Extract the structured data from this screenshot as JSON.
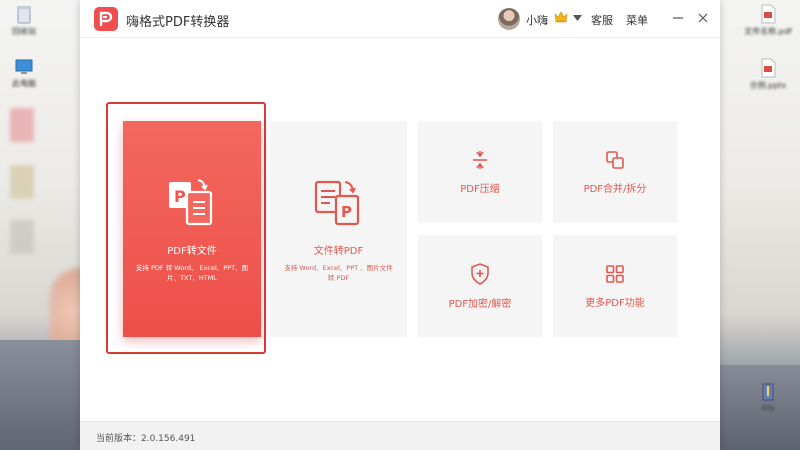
{
  "app": {
    "title": "嗨格式PDF转换器",
    "brand_color": "#f04e4e",
    "accent_text_color": "#e2584f"
  },
  "header": {
    "username": "小嗨",
    "support_label": "客服",
    "menu_label": "菜单",
    "icons": [
      "crown-icon",
      "chevron-down-icon",
      "minimize-icon",
      "close-icon"
    ]
  },
  "cards": {
    "pdf_to_file": {
      "title": "PDF转文件",
      "description": "支持 PDF 转 Word、 Excel、PPT、图片、TXT、HTML",
      "icon": "pdf-to-file-icon",
      "selected": true
    },
    "file_to_pdf": {
      "title": "文件转PDF",
      "description": "支持 Word、Excel、PPT 、图片文件转 PDF",
      "icon": "file-to-pdf-icon"
    },
    "compress": {
      "title": "PDF压缩",
      "icon": "compress-icon"
    },
    "merge_split": {
      "title": "PDF合并/拆分",
      "icon": "merge-split-icon"
    },
    "encrypt": {
      "title": "PDF加密/解密",
      "icon": "shield-icon"
    },
    "more": {
      "title": "更多PDF功能",
      "icon": "grid-icon"
    }
  },
  "status": {
    "version_label": "当前版本：2.0.156.491"
  }
}
